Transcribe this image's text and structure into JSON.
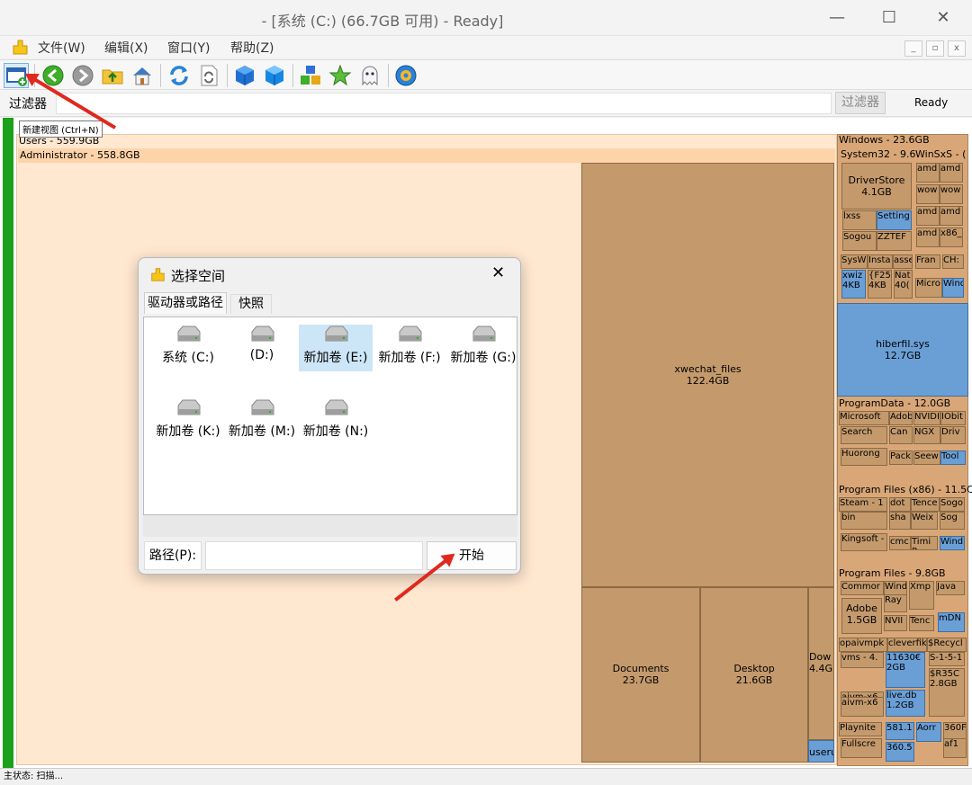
{
  "window": {
    "title": "- [系统 (C:) (66.7GB 可用) - Ready]"
  },
  "menu": {
    "file": "文件(W)",
    "edit": "编辑(X)",
    "window": "窗口(Y)",
    "help": "帮助(Z)"
  },
  "toolbar": {
    "tooltip": "新建视图 (Ctrl+N)"
  },
  "filterbar": {
    "label": "过滤器",
    "right_label": "过滤器",
    "status": "Ready"
  },
  "treemap": {
    "users": "Users - 559.9GB",
    "admin": "Administrator - 558.8GB",
    "xwechat": {
      "name": "xwechat_files",
      "size": "122.4GB"
    },
    "documents": {
      "name": "Documents",
      "size": "23.7GB"
    },
    "desktop": {
      "name": "Desktop",
      "size": "21.6GB"
    },
    "downloads": {
      "name": "Dow",
      "size": "4.4G"
    },
    "user_small": "useru",
    "windows": "Windows - 23.6GB",
    "system32": "System32 - 9.6",
    "winsxs": "WinSxS - (",
    "driverstore": {
      "name": "DriverStore",
      "size": "4.1GB"
    },
    "hiberfil": {
      "name": "hiberfil.sys",
      "size": "12.7GB"
    },
    "programdata": "ProgramData - 12.0GB",
    "pf86": "Program Files (x86) - 11.5C",
    "pf": "Program Files - 9.8GB",
    "adobe": {
      "name": "Adobe",
      "size": "1.5GB"
    },
    "small_labels": [
      "lxss",
      "Setting",
      "Sogou",
      "ZZTEF",
      "amd",
      "amd",
      "wow",
      "wow",
      "amd",
      "amd",
      "amd",
      "x86_",
      "SysW",
      "Insta",
      "asse",
      "Fran",
      "CH:",
      "xwiz 4KB",
      "{F25 4KB",
      "Nat 40(",
      "Micro",
      "Wind",
      "Microsoft",
      "Adob",
      "NVIDI",
      "IObit",
      "Search",
      "Can",
      "NGX",
      "Driv",
      "Huorong",
      "Pack",
      "Seew",
      "Tool",
      "Steam - 1",
      "dot",
      "Tence",
      "Sogo",
      "bin",
      "sha",
      "Weix",
      "Sog",
      "Kingsoft -",
      "cmc",
      "Timi P",
      "Wind",
      "Commor",
      "Wind",
      "Xmp",
      "Java",
      "Ray",
      "NVII",
      "Tenc",
      "mDN",
      "opaivmpk",
      "cleverfik",
      "$Recycl",
      "vms - 4.",
      "11630€ 2GB",
      "S-1-5-1",
      "aivm-x6",
      "aivm-x6",
      "live.db 1.2GB",
      "$R35C 2.8GB",
      "Playnite -",
      "581.1",
      "Aorr",
      "360F",
      "Fullscre",
      "360.5",
      "af1"
    ]
  },
  "dialog": {
    "title": "选择空间",
    "tab1": "驱动器或路径",
    "tab2": "快照",
    "drives": [
      "系统 (C:)",
      "(D:)",
      "新加卷 (E:)",
      "新加卷 (F:)",
      "新加卷 (G:)",
      "新加卷 (K:)",
      "新加卷 (M:)",
      "新加卷 (N:)"
    ],
    "path_label": "路径(P):",
    "path_value": "",
    "start_button": "开始"
  },
  "statusbar": {
    "text": "主状态: 扫描..."
  },
  "colors": {
    "folder_tan": "#c49a6c",
    "file_blue": "#6a9fd6",
    "highlight": "#fde3c8",
    "green_bar": "#1aa01a",
    "arrow_red": "#e0281e"
  }
}
